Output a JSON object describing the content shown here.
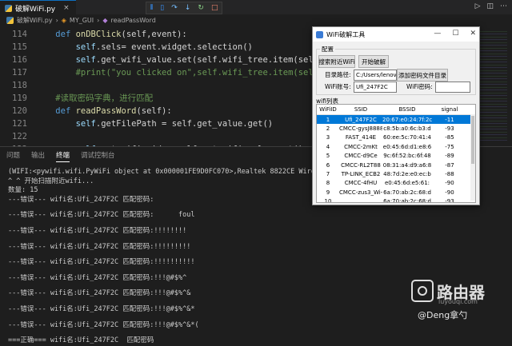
{
  "tab": {
    "title": "破解WiFi.py",
    "close": "×"
  },
  "toolbar": {
    "icons": [
      "run-icon",
      "split-icon",
      "debug-icon",
      "step-icon",
      "restart-icon",
      "stop-icon"
    ]
  },
  "breadcrumb": {
    "file": "破解WiFi.py",
    "class": "MY_GUI",
    "method": "readPassWord"
  },
  "editor": {
    "lines": [
      {
        "num": "114",
        "indent": "    ",
        "parts": [
          [
            "kw",
            "def "
          ],
          [
            "fn",
            "onDBClick"
          ],
          [
            "",
            "(self,event):"
          ]
        ]
      },
      {
        "num": "115",
        "indent": "        ",
        "parts": [
          [
            "self",
            "self"
          ],
          [
            "",
            ".sels= event.widget.selection()"
          ]
        ]
      },
      {
        "num": "116",
        "indent": "        ",
        "parts": [
          [
            "self",
            "self"
          ],
          [
            "",
            ".get_wifi_value.set(self.wifi_tree.item(self.sels,\"v"
          ]
        ]
      },
      {
        "num": "117",
        "indent": "        ",
        "parts": [
          [
            "cm",
            "#print(\"you clicked on\",self.wifi_tree.item(self.sels,\"v"
          ]
        ]
      },
      {
        "num": "118",
        "indent": "",
        "parts": [
          [
            "",
            ""
          ]
        ]
      },
      {
        "num": "119",
        "indent": "    ",
        "parts": [
          [
            "cm",
            "#读取密码字典，进行匹配"
          ]
        ]
      },
      {
        "num": "120",
        "indent": "    ",
        "parts": [
          [
            "kw",
            "def "
          ],
          [
            "fn",
            "readPassWord"
          ],
          [
            "",
            "(self):"
          ]
        ]
      },
      {
        "num": "121",
        "indent": "        ",
        "parts": [
          [
            "self",
            "self"
          ],
          [
            "",
            ".getFilePath = self.get_value.get()"
          ]
        ]
      },
      {
        "num": "122",
        "indent": "",
        "parts": [
          [
            "",
            ""
          ]
        ]
      },
      {
        "num": "123",
        "indent": "        ",
        "parts": [
          [
            "self",
            "self"
          ],
          [
            "",
            ".get_wifissid = self.get_wifi_value.get()"
          ]
        ]
      }
    ]
  },
  "panel": {
    "tabs": [
      "问题",
      "输出",
      "终端",
      "调试控制台"
    ],
    "active_tab": "终端",
    "terminal_lines": [
      "(WIFI:<pywifi.wifi.PyWiFi object at 0x000001FE9D0FC070>,Realtek 8822CE Wireless LAN 802.11ac PCI",
      "^ ^ 开始扫描附近wifi...",
      "数量: 15",
      "---错误--- wifi名:Ufi_247F2C 匹配密码:",
      "",
      "---错误--- wifi名:Ufi_247F2C 匹配密码:      foul",
      "",
      "---错误--- wifi名:Ufi_247F2C 匹配密码:!!!!!!!!",
      "",
      "---错误--- wifi名:Ufi_247F2C 匹配密码:!!!!!!!!!",
      "",
      "---错误--- wifi名:Ufi_247F2C 匹配密码:!!!!!!!!!!",
      "",
      "---错误--- wifi名:Ufi_247F2C 匹配密码:!!!@#$%^",
      "",
      "---错误--- wifi名:Ufi_247F2C 匹配密码:!!!@#$%^&",
      "",
      "---错误--- wifi名:Ufi_247F2C 匹配密码:!!!@#$%^&*",
      "",
      "---错误--- wifi名:Ufi_247F2C 匹配密码:!!!@#$%^&*(",
      "",
      "===正确=== wifi名:Ufi_247F2C  匹配密码"
    ]
  },
  "window": {
    "title": "WiFi破解工具",
    "controls": [
      "—",
      "☐",
      "✕"
    ],
    "group_label": "配置",
    "scan_button": "搜索附近WiFi",
    "start_button": "开始破解",
    "dir_label": "目录路径:",
    "dir_value": "C:/Users/lenov",
    "add_dict_button": "添加密码文件目录",
    "wifi_account_label": "WiFi账号:",
    "wifi_account_value": "Ufi_247F2C",
    "wifi_password_label": "WiFi密码:",
    "wifi_password_value": "",
    "list_label": "wifi列表",
    "columns": [
      "WiFiID",
      "SSID",
      "BSSID",
      "signal"
    ],
    "rows": [
      [
        "1",
        "Ufi_247F2C",
        "20:67:e0:24:7f:2c",
        "-11"
      ],
      [
        "2",
        "CMCC-gysJ8888",
        "c8:5b:a0:6c:b3:d",
        "-93"
      ],
      [
        "3",
        "FAST_414E",
        "60:ee:5c:70:41:4",
        "-85"
      ],
      [
        "4",
        "CMCC-2mKt",
        "e0:45:6d:d1:e8:6",
        "-75"
      ],
      [
        "5",
        "CMCC-d9Ce",
        "9c:6f:52:bc:6f:48",
        "-89"
      ],
      [
        "6",
        "CMCC-RL2T88",
        "08:31:a4:d9:a6:8",
        "-87"
      ],
      [
        "7",
        "TP-LINK_ECB2",
        "48:7d:2e:e0:ec:b",
        "-88"
      ],
      [
        "8",
        "CMCC-4fHU",
        "e0:45:6d:e5:61:",
        "-90"
      ],
      [
        "9",
        "CMCC-zus3_Wi-",
        "6a:70:ab:2c:68:d",
        "-90"
      ],
      [
        "10",
        "",
        "6a:70:ab:2c:68:d",
        "-93"
      ]
    ],
    "selected_row": 0
  },
  "watermark": {
    "title": "路由器",
    "subtitle": "luyouqi.com",
    "author": "@Deng拿勺"
  }
}
